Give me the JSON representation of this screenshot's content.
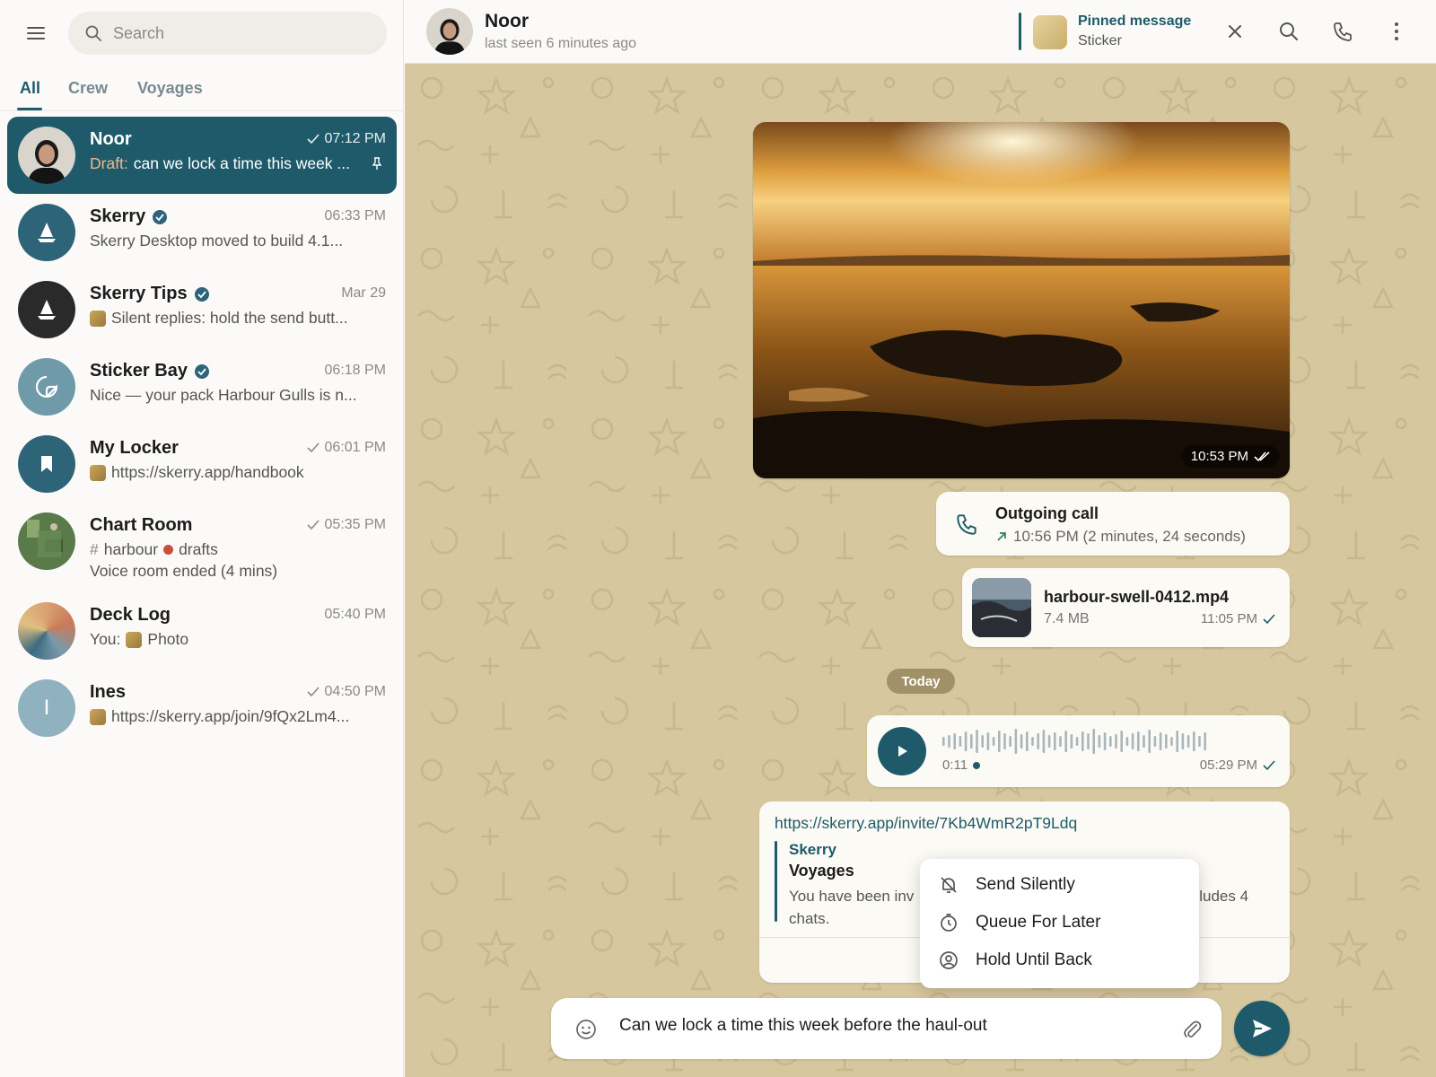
{
  "sidebar": {
    "search_placeholder": "Search",
    "tabs": [
      {
        "label": "All"
      },
      {
        "label": "Crew"
      },
      {
        "label": "Voyages"
      }
    ],
    "chats": [
      {
        "name": "Noor",
        "time": "07:12 PM",
        "draft_label": "Draft:",
        "preview": "can we lock a time this week ..."
      },
      {
        "name": "Skerry",
        "time": "06:33 PM",
        "preview": "Skerry Desktop moved to build 4.1..."
      },
      {
        "name": "Skerry Tips",
        "time": "Mar 29",
        "preview": "Silent replies: hold the send butt..."
      },
      {
        "name": "Sticker Bay",
        "time": "06:18 PM",
        "preview": "Nice — your pack Harbour Gulls is n..."
      },
      {
        "name": "My Locker",
        "time": "06:01 PM",
        "preview": "https://skerry.app/handbook"
      },
      {
        "name": "Chart Room",
        "time": "05:35 PM",
        "topic_hash": "#",
        "topic_a": "harbour",
        "topic_b": "drafts",
        "preview": "Voice room ended (4 mins)"
      },
      {
        "name": "Deck Log",
        "time": "05:40 PM",
        "preview_prefix": "You:",
        "preview": "Photo"
      },
      {
        "name": "Ines",
        "time": "04:50 PM",
        "avatar_letter": "I",
        "preview": "https://skerry.app/join/9fQx2Lm4..."
      }
    ]
  },
  "header": {
    "name": "Noor",
    "status": "last seen 6 minutes ago",
    "pinned_title": "Pinned message",
    "pinned_sub": "Sticker"
  },
  "messages": {
    "photo_time": "10:53 PM",
    "call_title": "Outgoing call",
    "call_detail": "10:56 PM (2 minutes, 24 seconds)",
    "file_name": "harbour-swell-0412.mp4",
    "file_size": "7.4 MB",
    "file_time": "11:05 PM",
    "day_separator": "Today",
    "voice_duration": "0:11",
    "voice_time": "05:29 PM",
    "link_url": "https://skerry.app/invite/7Kb4WmR2pT9Ldq",
    "preview_site": "Skerry",
    "preview_title": "Voyages",
    "preview_desc_start": "You have been inv",
    "preview_desc_end": "ncludes 4",
    "preview_desc_line2": "chats."
  },
  "context_menu": {
    "items": [
      {
        "label": "Send Silently",
        "icon": "bell-off-icon"
      },
      {
        "label": "Queue For Later",
        "icon": "timer-icon"
      },
      {
        "label": "Hold Until Back",
        "icon": "user-circle-icon"
      }
    ]
  },
  "composer": {
    "value": "Can we lock a time this week before the haul-out"
  },
  "colors": {
    "accent": "#1f5a6b",
    "wallpaper": "#d6c79e",
    "bubble": "#fbfaf4"
  }
}
